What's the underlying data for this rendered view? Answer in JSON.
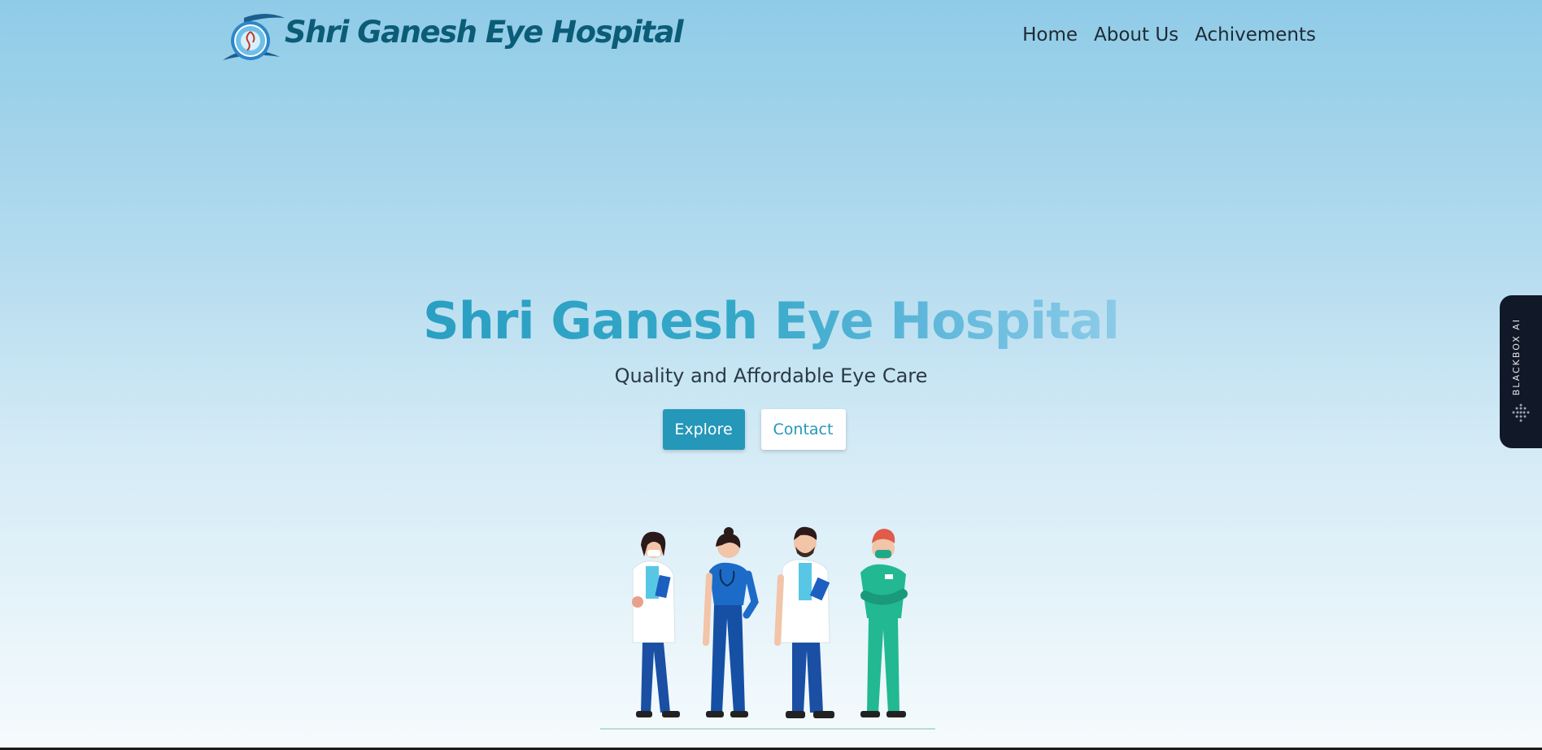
{
  "header": {
    "brand": "Shri Ganesh Eye Hospital",
    "logo_icon": "ganesh-eye-logo",
    "nav": [
      "Home",
      "About Us",
      "Achivements"
    ]
  },
  "hero": {
    "title": "Shri Ganesh Eye Hospital",
    "subtitle": "Quality and Affordable Eye Care",
    "explore_label": "Explore",
    "contact_label": "Contact",
    "illustration": "medical-team-illustration"
  },
  "blackbox": {
    "label": "BLACKBOX AI"
  },
  "colors": {
    "brand": "#0b5c77",
    "accent": "#2597b8",
    "bg_top": "#8fcbe7",
    "bg_bottom": "#f6fbfd"
  }
}
